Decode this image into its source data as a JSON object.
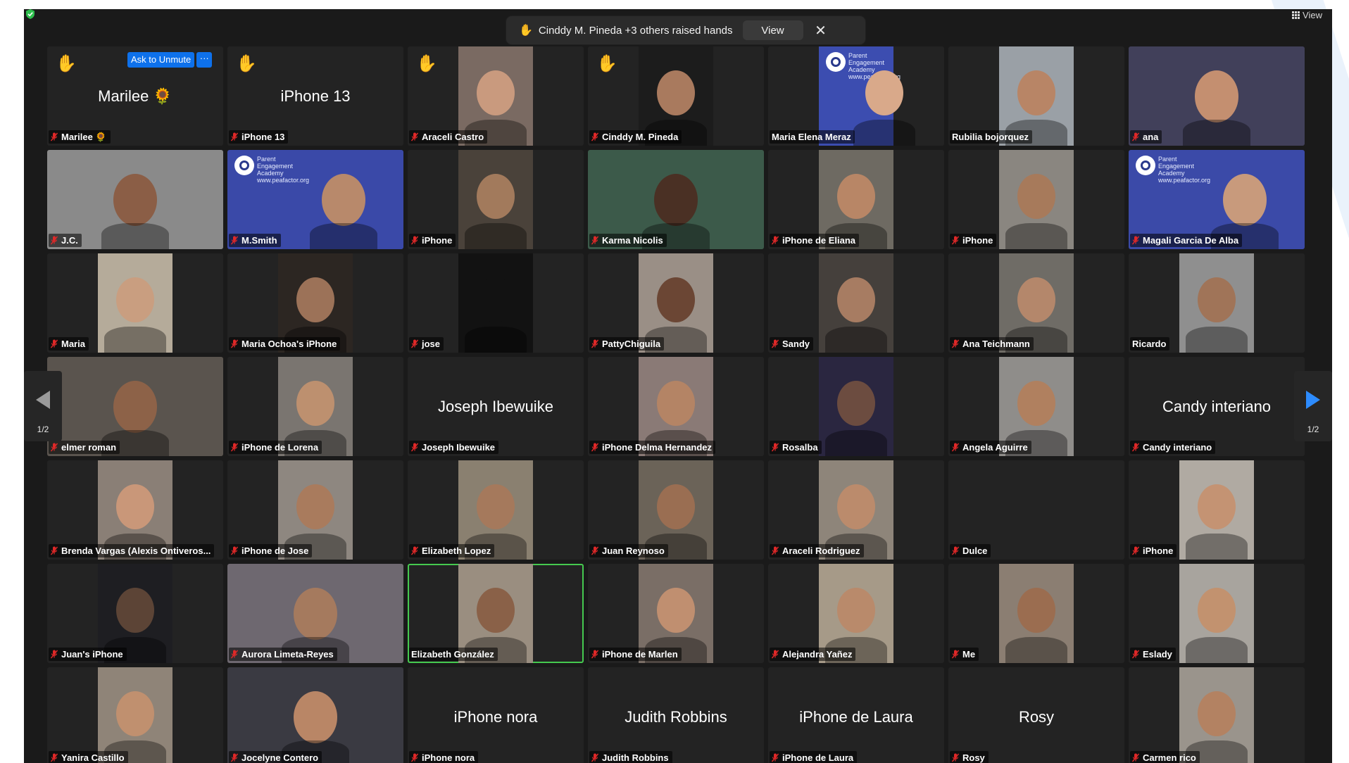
{
  "banner": {
    "message": "Cinddy M. Pineda +3 others raised hands",
    "view_label": "View",
    "close_label": "✕"
  },
  "toolbar": {
    "view_label": "View"
  },
  "ask_to_unmute": {
    "label": "Ask to Unmute",
    "more_label": "···"
  },
  "pagination": {
    "left": "1/2",
    "right": "1/2"
  },
  "colors": {
    "hand": "#f4c21a",
    "active_speaker": "#45c94f",
    "accent": "#0e71eb",
    "mute": "#e02828"
  },
  "tiles": [
    {
      "name": "Marilee 🌻",
      "big": "Marilee 🌻",
      "hand": true,
      "unmute": true,
      "muted": true
    },
    {
      "name": "iPhone 13",
      "big": "iPhone 13",
      "hand": true,
      "muted": true
    },
    {
      "name": "Araceli Castro",
      "hand": true,
      "muted": true,
      "bg": "#7a6a62",
      "skin": "#c99a7e"
    },
    {
      "name": "Cinddy M. Pineda",
      "hand": true,
      "muted": true,
      "bg": "#1c1c1c",
      "skin": "#a97a5e"
    },
    {
      "name": "Maria Elena Meraz",
      "muted": false,
      "bg": "#3c4db0",
      "skin": "#d9a98a",
      "pea": true
    },
    {
      "name": "Rubilia bojorquez",
      "muted": false,
      "bg": "#9aa0a6",
      "skin": "#b88566"
    },
    {
      "name": "ana",
      "muted": true,
      "bg": "#41405a",
      "skin": "#c48f70",
      "full": true
    },
    {
      "name": "J.C.",
      "muted": true,
      "bg": "#8a8a8a",
      "skin": "#8b5e46",
      "full": true
    },
    {
      "name": "M.Smith",
      "muted": true,
      "bg": "#3a49a8",
      "skin": "#b8896b",
      "pea": true,
      "full": true
    },
    {
      "name": "iPhone",
      "muted": true,
      "bg": "#4a423a",
      "skin": "#a27a5c"
    },
    {
      "name": "Karma Nicolis",
      "muted": true,
      "bg": "#3c5a4a",
      "skin": "#4a3024",
      "full": true
    },
    {
      "name": "iPhone de Eliana",
      "muted": true,
      "bg": "#6e6a62",
      "skin": "#b88666"
    },
    {
      "name": "iPhone",
      "muted": true,
      "bg": "#8a8680",
      "skin": "#a77a5b"
    },
    {
      "name": "Magali Garcia De Alba",
      "muted": true,
      "bg": "#3b4aa8",
      "skin": "#c89a7c",
      "pea": true,
      "full": true
    },
    {
      "name": "Maria",
      "muted": true,
      "bg": "#b5ab9a",
      "skin": "#c99e80"
    },
    {
      "name": "Maria Ochoa's iPhone",
      "muted": true,
      "bg": "#2c2622",
      "skin": "#9c7258"
    },
    {
      "name": "jose",
      "muted": true,
      "bg": "#121212",
      "skin": "#121212"
    },
    {
      "name": "PattyChiguila",
      "muted": true,
      "bg": "#9a8f86",
      "skin": "#6b4634"
    },
    {
      "name": "Sandy",
      "muted": true,
      "bg": "#45403c",
      "skin": "#a77c62"
    },
    {
      "name": "Ana Teichmann",
      "muted": true,
      "bg": "#6f6c66",
      "skin": "#b4876b"
    },
    {
      "name": "Ricardo",
      "muted": false,
      "bg": "#8f8f8f",
      "skin": "#a07458"
    },
    {
      "name": "elmer roman",
      "muted": true,
      "bg": "#5a544e",
      "skin": "#8d6248",
      "full": true
    },
    {
      "name": "iPhone de Lorena",
      "muted": true,
      "bg": "#7a7570",
      "skin": "#bd906f"
    },
    {
      "name": "Joseph Ibewuike",
      "big": "Joseph Ibewuike",
      "muted": true
    },
    {
      "name": "iPhone Delma Hernandez",
      "muted": true,
      "bg": "#8a7a76",
      "skin": "#b48465"
    },
    {
      "name": "Rosalba",
      "muted": true,
      "bg": "#2a2640",
      "skin": "#6c4c40"
    },
    {
      "name": "Angela Aguirre",
      "muted": true,
      "bg": "#8f8d8a",
      "skin": "#b0805f"
    },
    {
      "name": "Candy interiano",
      "big": "Candy interiano",
      "muted": true
    },
    {
      "name": "Brenda Vargas (Alexis Ontiveros...",
      "muted": true,
      "bg": "#8a7f76",
      "skin": "#c99779"
    },
    {
      "name": "iPhone de Jose",
      "muted": true,
      "bg": "#8e8780",
      "skin": "#a97b5d"
    },
    {
      "name": "Elizabeth Lopez",
      "muted": true,
      "bg": "#8a8070",
      "skin": "#a5795c"
    },
    {
      "name": "Juan Reynoso",
      "muted": true,
      "bg": "#6b6358",
      "skin": "#9a6e52"
    },
    {
      "name": "Araceli Rodriguez",
      "muted": true,
      "bg": "#8e857a",
      "skin": "#bb8b6c"
    },
    {
      "name": "Dulce",
      "muted": true
    },
    {
      "name": "iPhone",
      "muted": true,
      "bg": "#b0aaa2",
      "skin": "#c49373"
    },
    {
      "name": "Juan's iPhone",
      "muted": true,
      "bg": "#1e1e22",
      "skin": "#5c4436"
    },
    {
      "name": "Aurora Limeta-Reyes",
      "muted": true,
      "bg": "#6e6870",
      "skin": "#a57a5e",
      "full": true
    },
    {
      "name": "Elizabeth González",
      "muted": false,
      "bg": "#9a8e80",
      "skin": "#8a6148",
      "active": true
    },
    {
      "name": "iPhone de Marlen",
      "muted": true,
      "bg": "#7a6e66",
      "skin": "#c08f70"
    },
    {
      "name": "Alejandra Yañez",
      "muted": true,
      "bg": "#a69a88",
      "skin": "#b98a6b"
    },
    {
      "name": "Me",
      "muted": true,
      "bg": "#8b7e72",
      "skin": "#9b6d50"
    },
    {
      "name": "Eslady",
      "muted": true,
      "bg": "#a8a49e",
      "skin": "#c2926f"
    },
    {
      "name": "Yanira Castillo",
      "muted": true,
      "bg": "#8f8478",
      "skin": "#c0906f"
    },
    {
      "name": "Jocelyne Contero",
      "muted": true,
      "bg": "#3a3a42",
      "skin": "#b98666",
      "full": true
    },
    {
      "name": "iPhone nora",
      "big": "iPhone nora",
      "muted": true
    },
    {
      "name": "Judith Robbins",
      "big": "Judith Robbins",
      "muted": true
    },
    {
      "name": "iPhone de Laura",
      "big": "iPhone de Laura",
      "muted": true
    },
    {
      "name": "Rosy",
      "big": "Rosy",
      "muted": true
    },
    {
      "name": "Carmen rico",
      "muted": true,
      "bg": "#9a948c",
      "skin": "#b38262"
    }
  ],
  "pea_logo": {
    "line1": "Parent",
    "line2": "Engagement",
    "line3": "Academy",
    "url": "www.peafactor.org"
  }
}
